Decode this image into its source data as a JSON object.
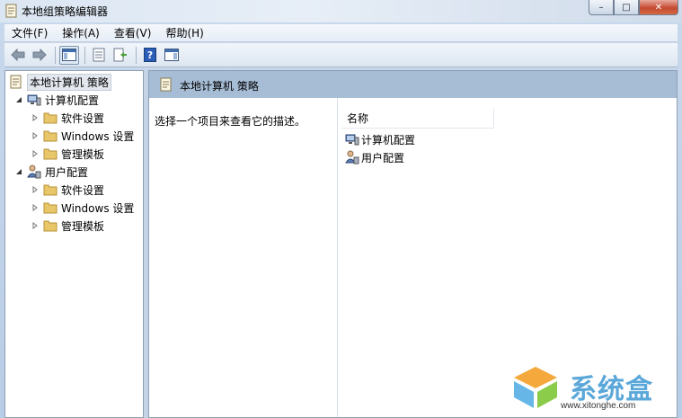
{
  "window": {
    "title": "本地组策略编辑器",
    "controls": {
      "minimize": "–",
      "maximize": "□",
      "close": "✕"
    }
  },
  "menubar": {
    "items": [
      "文件(F)",
      "操作(A)",
      "查看(V)",
      "帮助(H)"
    ]
  },
  "toolbar": {
    "buttons": [
      "back-arrow-icon",
      "forward-arrow-icon",
      "show-hide-tree-icon",
      "properties-icon",
      "export-list-icon",
      "help-icon",
      "show-hide-action-pane-icon"
    ]
  },
  "tree": {
    "root": "本地计算机 策略",
    "computer_config": {
      "label": "计算机配置",
      "children": [
        "软件设置",
        "Windows 设置",
        "管理模板"
      ]
    },
    "user_config": {
      "label": "用户配置",
      "children": [
        "软件设置",
        "Windows 设置",
        "管理模板"
      ]
    }
  },
  "details": {
    "header_title": "本地计算机 策略",
    "description": "选择一个项目来查看它的描述。",
    "column_name": "名称",
    "items": [
      "计算机配置",
      "用户配置"
    ]
  },
  "watermark": {
    "brand": "系统盒",
    "url": "www.xitonghe.com"
  },
  "colors": {
    "header_band": "#a7bdd6",
    "title_gradient": "#dbe6f3",
    "folder": "#e8c66a",
    "desktop_background": "#7a1f24"
  }
}
